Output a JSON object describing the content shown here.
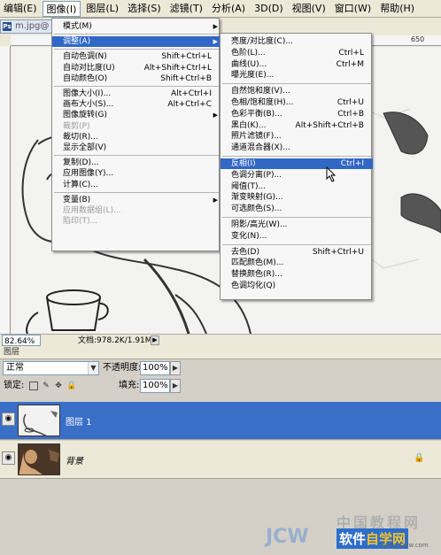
{
  "menubar": [
    {
      "label": "编辑(E)"
    },
    {
      "label": "图像(I)",
      "active": true
    },
    {
      "label": "图层(L)"
    },
    {
      "label": "选择(S)"
    },
    {
      "label": "滤镜(T)"
    },
    {
      "label": "分析(A)"
    },
    {
      "label": "3D(D)"
    },
    {
      "label": "视图(V)"
    },
    {
      "label": "窗口(W)"
    },
    {
      "label": "帮助(H)"
    }
  ],
  "document": {
    "tab_title": "m.jpg@",
    "ruler_mark": "650",
    "zoom": "82.64%",
    "doc_size": "文档:978.2K/1.91M"
  },
  "image_menu": {
    "items": [
      {
        "label": "模式(M)",
        "submenu": true
      },
      {
        "label": "调整(A)",
        "submenu": true,
        "highlighted": true
      },
      {
        "label": "自动色调(N)",
        "shortcut": "Shift+Ctrl+L"
      },
      {
        "label": "自动对比度(U)",
        "shortcut": "Alt+Shift+Ctrl+L"
      },
      {
        "label": "自动颜色(O)",
        "shortcut": "Shift+Ctrl+B"
      },
      {
        "label": "图像大小(I)...",
        "shortcut": "Alt+Ctrl+I"
      },
      {
        "label": "画布大小(S)...",
        "shortcut": "Alt+Ctrl+C"
      },
      {
        "label": "图像旋转(G)",
        "submenu": true
      },
      {
        "label": "裁剪(P)",
        "disabled": true
      },
      {
        "label": "裁切(R)..."
      },
      {
        "label": "显示全部(V)"
      },
      {
        "label": "复制(D)..."
      },
      {
        "label": "应用图像(Y)..."
      },
      {
        "label": "计算(C)..."
      },
      {
        "label": "变量(B)",
        "submenu": true
      },
      {
        "label": "应用数据组(L)...",
        "disabled": true
      },
      {
        "label": "陷印(T)...",
        "disabled": true
      }
    ]
  },
  "adjust_menu": {
    "items": [
      {
        "label": "亮度/对比度(C)..."
      },
      {
        "label": "色阶(L)...",
        "shortcut": "Ctrl+L"
      },
      {
        "label": "曲线(U)...",
        "shortcut": "Ctrl+M"
      },
      {
        "label": "曝光度(E)..."
      },
      {
        "label": "自然饱和度(V)..."
      },
      {
        "label": "色相/饱和度(H)...",
        "shortcut": "Ctrl+U"
      },
      {
        "label": "色彩平衡(B)...",
        "shortcut": "Ctrl+B"
      },
      {
        "label": "黑白(K)...",
        "shortcut": "Alt+Shift+Ctrl+B"
      },
      {
        "label": "照片滤镜(F)..."
      },
      {
        "label": "通道混合器(X)..."
      },
      {
        "label": "反相(I)",
        "shortcut": "Ctrl+I",
        "highlighted": true
      },
      {
        "label": "色调分离(P)..."
      },
      {
        "label": "阈值(T)..."
      },
      {
        "label": "渐变映射(G)..."
      },
      {
        "label": "可选颜色(S)..."
      },
      {
        "label": "阴影/高光(W)..."
      },
      {
        "label": "变化(N)..."
      },
      {
        "label": "去色(D)",
        "shortcut": "Shift+Ctrl+U"
      },
      {
        "label": "匹配颜色(M)..."
      },
      {
        "label": "替换颜色(R)..."
      },
      {
        "label": "色调均化(Q)"
      }
    ]
  },
  "layers_panel": {
    "title": "图层",
    "blend_mode": "正常",
    "opacity_label": "不透明度:",
    "opacity": "100%",
    "lock_label": "锁定:",
    "fill_label": "填充:",
    "fill": "100%",
    "layers": [
      {
        "name": "图层 1",
        "selected": true
      },
      {
        "name": "背景",
        "selected": false,
        "locked": true
      }
    ]
  },
  "watermark": {
    "line1": "中国教程网",
    "brand": "JCW",
    "site_a": "软件",
    "site_b": "自学网",
    "url": "www.rjzxw.com"
  },
  "colors": {
    "highlight": "#3168c6",
    "selected_layer": "#3a6fc8"
  }
}
